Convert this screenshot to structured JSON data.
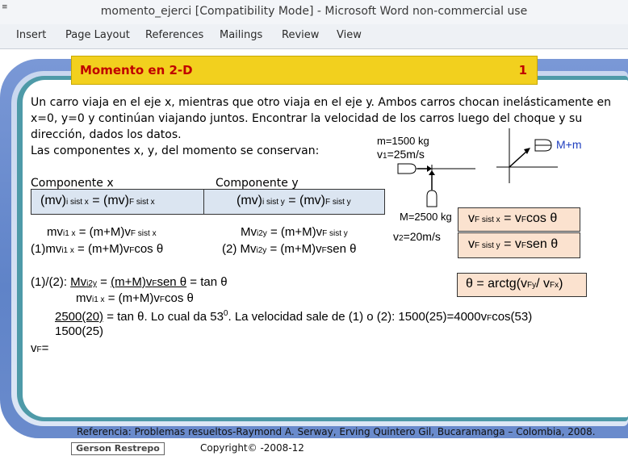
{
  "window": {
    "title": "momento_ejerci [Compatibility Mode] - Microsoft Word non-commercial use",
    "quick_access": "≡"
  },
  "ribbon": {
    "tabs": [
      "Insert",
      "Page Layout",
      "References",
      "Mailings",
      "Review",
      "View"
    ]
  },
  "slide": {
    "header_title": "Momento en 2-D",
    "header_number": "1",
    "problem_lines": [
      "Un carro viaja en el eje x, mientras que otro viaja en el eje y. Ambos carros chocan inelásticamente en",
      "x=0, y=0 y continúan viajando juntos. Encontrar la velocidad de los carros luego del choque y su",
      "dirección, dados los datos.",
      "Las componentes x, y, del momento se conservan:"
    ],
    "component_x_label": "Componente x",
    "component_y_label": "Componente y",
    "eq_box_x": {
      "a": "(mv)",
      "a_sub": "i sist x",
      "eq": " = (mv)",
      "b_sub": "F sist x"
    },
    "eq_box_y": {
      "a": "(mv)",
      "a_sub": "i sist y",
      "eq": " = (mv)",
      "b_sub": "F sist y"
    },
    "eq_x1": {
      "a": "mv",
      "a_sub": "i1 x",
      "mid": "  = (m+M)v",
      "b_sub": "F sist x"
    },
    "eq_x2": {
      "pre": "(1)mv",
      "a_sub": "i1 x",
      "mid": "  = (m+M)v",
      "b_sub": "F",
      "post": "cos θ"
    },
    "eq_y1": {
      "a": "Mv",
      "a_sub": "i2y",
      "mid": "  = (m+M)v",
      "b_sub": "F sist y"
    },
    "eq_y2": {
      "pre": "(2) Mv",
      "a_sub": "i2y",
      "mid": "  = (m+M)v",
      "b_sub": "F",
      "post": "sen θ"
    },
    "div_line1": {
      "pre": "(1)/(2):  ",
      "num": "Mv",
      "num_sub": "i2y",
      "mid": "  = ",
      "num2": "(m+M)v",
      "num2_sub": "F",
      "num2_post": "sen θ",
      "post": "  = tan θ"
    },
    "div_line2": {
      "den": "mv",
      "den_sub": "i1 x",
      "mid": "  = (m+M)v",
      "den2_sub": "F",
      "post": "cos θ"
    },
    "calc_line": {
      "num": "2500(20)",
      "text": " = tan θ. Lo cual da 53",
      "sup": "0",
      "text2": ". La velocidad sale de (1) o (2):  1500(25)=4000v",
      "sub": "F",
      "text3": "cos(53)"
    },
    "calc_den": "1500(25)",
    "vf_label": {
      "a": "v",
      "sub": "F",
      "post": "="
    },
    "diagram": {
      "m_label": "m=1500 kg",
      "v1_label": "v",
      "v1_sub": "1",
      "v1_post": "=25m/s",
      "M_label": "M=2500 kg",
      "v2_label": "v",
      "v2_sub": "2",
      "v2_post": "=20m/s",
      "mm_label": "M+m",
      "mm_color": "#1f3fbf"
    },
    "tan_box1": {
      "a": "v",
      "a_sub": "F  sist x",
      "mid": " = v",
      "b_sub": "F",
      "post": "cos θ"
    },
    "tan_box2": {
      "a": "v",
      "a_sub": "F  sist y",
      "mid": " = v",
      "b_sub": "F",
      "post": "sen θ"
    },
    "theta_box": {
      "pre": "θ = arctg(v",
      "s1": "Fy",
      "mid": "/ v",
      "s2": "Fx",
      "post": ")"
    }
  },
  "footer": {
    "reference": "Referencia: Problemas resueltos-Raymond A. Serway, Erving Quintero Gil, Bucaramanga – Colombia, 2008.",
    "author": "Gerson Restrepo",
    "copyright": "Copyright© -2008-12"
  },
  "colors": {
    "header_bg": "#f2d01e",
    "header_text": "#c00000",
    "frame_blue": "#6a8bcc",
    "frame_teal": "#4e9aa8",
    "eq_box": "#dbe5f1",
    "result_box": "#fbe2cf"
  }
}
